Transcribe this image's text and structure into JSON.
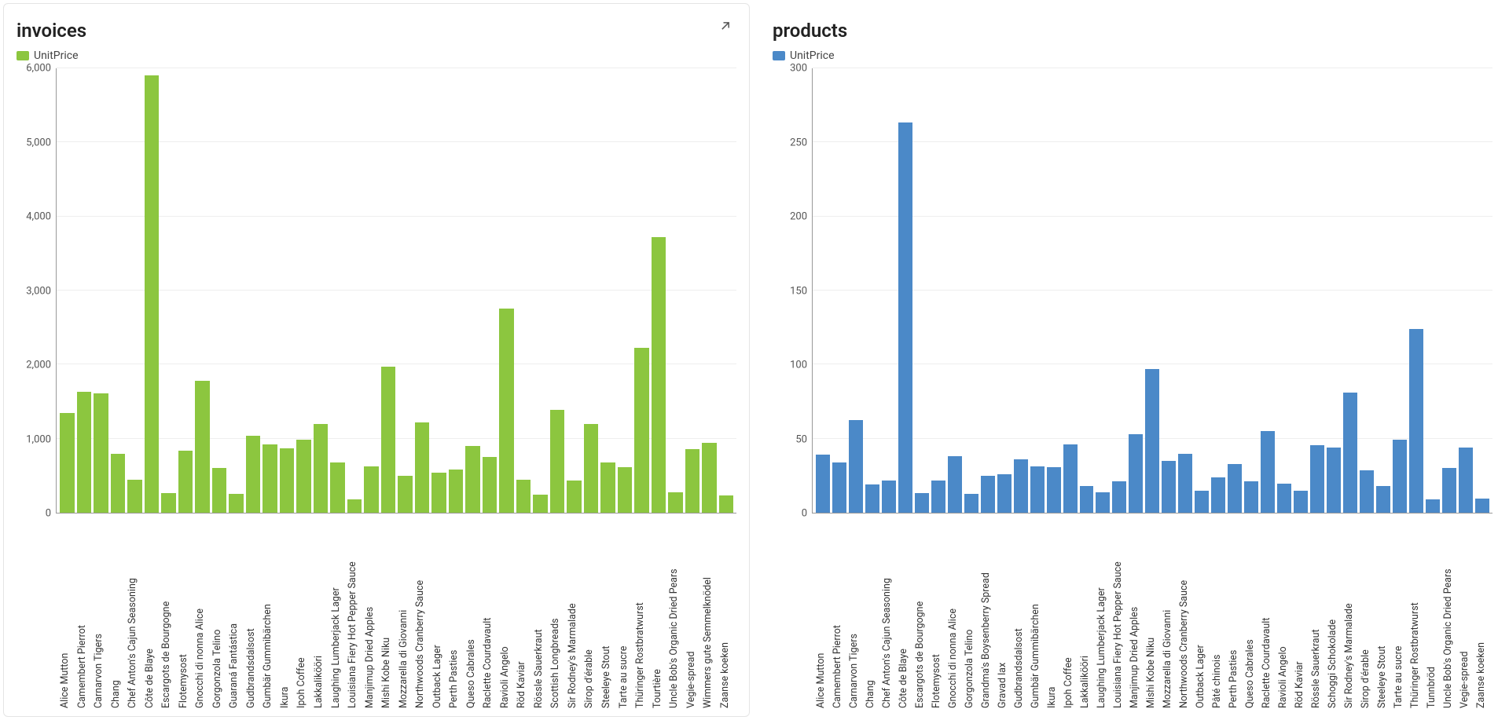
{
  "chart_data": [
    {
      "id": "invoices",
      "type": "bar",
      "title": "invoices",
      "legend_label": "UnitPrice",
      "color": "#8cc63f",
      "ylim": [
        0,
        6000
      ],
      "yticks": [
        0,
        1000,
        2000,
        3000,
        4000,
        5000,
        6000
      ],
      "ytick_labels": [
        "0",
        "1,000",
        "2,000",
        "3,000",
        "4,000",
        "5,000",
        "6,000"
      ],
      "categories": [
        "Alice Mutton",
        "Camembert Pierrot",
        "Carnarvon Tigers",
        "Chang",
        "Chef Anton's Cajun Seasoning",
        "Côte de Blaye",
        "Escargots de Bourgogne",
        "Flotemysost",
        "Gnocchi di nonna Alice",
        "Gorgonzola Telino",
        "Guaraná Fantástica",
        "Gudbrandsdalsost",
        "Gumbär Gummibärchen",
        "Ikura",
        "Ipoh Coffee",
        "Lakkalikööri",
        "Laughing Lumberjack Lager",
        "Louisiana Fiery Hot Pepper Sauce",
        "Manjimup Dried Apples",
        "Mishi Kobe Niku",
        "Mozzarella di Giovanni",
        "Northwoods Cranberry Sauce",
        "Outback Lager",
        "Perth Pasties",
        "Queso Cabrales",
        "Raclette Courdavault",
        "Ravioli Angelo",
        "Röd Kaviar",
        "Rössle Sauerkraut",
        "Scottish Longbreads",
        "Sir Rodney's Marmalade",
        "Sirop d'érable",
        "Steeleye Stout",
        "Tarte au sucre",
        "Thüringer Rostbratwurst",
        "Tourtière",
        "Uncle Bob's Organic Dried Pears",
        "Vegie-spread",
        "Wimmers gute Semmelknödel",
        "Zaanse koeken"
      ],
      "values": [
        1350,
        1630,
        1610,
        800,
        450,
        5900,
        260,
        840,
        1780,
        600,
        250,
        1040,
        920,
        870,
        990,
        1200,
        680,
        180,
        630,
        1970,
        500,
        1220,
        540,
        580,
        900,
        750,
        2760,
        450,
        240,
        1390,
        430,
        1200,
        680,
        620,
        2230,
        3720,
        280,
        860,
        940,
        230
      ]
    },
    {
      "id": "products",
      "type": "bar",
      "title": "products",
      "legend_label": "UnitPrice",
      "color": "#4b89c8",
      "ylim": [
        0,
        300
      ],
      "yticks": [
        0,
        50,
        100,
        150,
        200,
        250,
        300
      ],
      "ytick_labels": [
        "0",
        "50",
        "100",
        "150",
        "200",
        "250",
        "300"
      ],
      "categories": [
        "Alice Mutton",
        "Camembert Pierrot",
        "Carnarvon Tigers",
        "Chang",
        "Chef Anton's Cajun Seasoning",
        "Côte de Blaye",
        "Escargots de Bourgogne",
        "Flotemysost",
        "Gnocchi di nonna Alice",
        "Gorgonzola Telino",
        "Grandma's Boysenberry Spread",
        "Gravad lax",
        "Gudbrandsdalsost",
        "Gumbär Gummibärchen",
        "Ikura",
        "Ipoh Coffee",
        "Lakkalikööri",
        "Laughing Lumberjack Lager",
        "Louisiana Fiery Hot Pepper Sauce",
        "Manjimup Dried Apples",
        "Mishi Kobe Niku",
        "Mozzarella di Giovanni",
        "Northwoods Cranberry Sauce",
        "Outback Lager",
        "Pâté chinois",
        "Perth Pasties",
        "Queso Cabrales",
        "Raclette Courdavault",
        "Ravioli Angelo",
        "Röd Kaviar",
        "Rössle Sauerkraut",
        "Schoggi Schokolade",
        "Sir Rodney's Marmalade",
        "Sirop d'érable",
        "Steeleye Stout",
        "Tarte au sucre",
        "Thüringer Rostbratwurst",
        "Tunnbröd",
        "Uncle Bob's Organic Dried Pears",
        "Vegie-spread",
        "Zaanse koeken"
      ],
      "values": [
        39,
        34,
        62.5,
        19,
        22,
        263.5,
        13.25,
        21.5,
        38,
        12.5,
        25,
        26,
        36,
        31.23,
        31,
        46,
        18,
        14,
        21.05,
        53,
        97,
        34.8,
        40,
        15,
        24,
        32.8,
        21,
        55,
        19.5,
        15,
        45.6,
        43.9,
        81,
        28.5,
        18,
        49.3,
        123.79,
        9,
        30,
        43.9,
        9.5
      ]
    }
  ]
}
